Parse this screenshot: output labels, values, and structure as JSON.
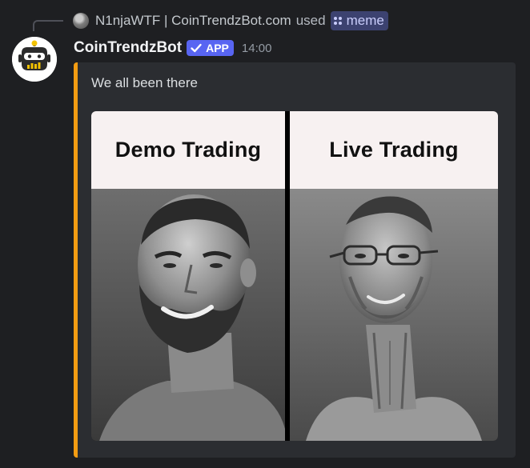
{
  "reply": {
    "user": "N1njaWTF | CoinTrendzBot.com",
    "used": "used",
    "command": "meme"
  },
  "message": {
    "author": "CoinTrendzBot",
    "badge": "APP",
    "timestamp": "14:00"
  },
  "embed": {
    "accent_color": "#f39c12",
    "description": "We all been there",
    "meme": {
      "left_label": "Demo Trading",
      "right_label": "Live Trading"
    }
  },
  "colors": {
    "background": "#1e1f22",
    "embed_background": "#2b2d31",
    "badge": "#5865f2",
    "command_chip": "#3c4270"
  }
}
